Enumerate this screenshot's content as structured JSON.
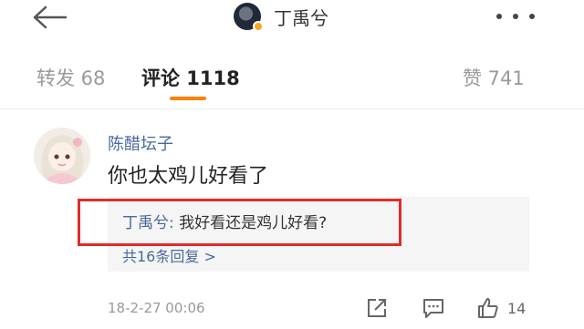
{
  "header": {
    "owner_name": "丁禹兮"
  },
  "tabs": {
    "repost": "转发 68",
    "comment": "评论 1118",
    "like": "赞 741"
  },
  "comment": {
    "author": "陈醋坛子",
    "text": "你也太鸡儿好看了",
    "reply": {
      "author": "丁禹兮:",
      "text": " 我好看还是鸡儿好看?"
    },
    "reply_count": "共16条回复 >",
    "timestamp": "18-2-27 00:06",
    "like_count": "14"
  },
  "colors": {
    "accent": "#ff8200",
    "link": "#4a6a9a",
    "highlight_box": "#e22a2a"
  }
}
